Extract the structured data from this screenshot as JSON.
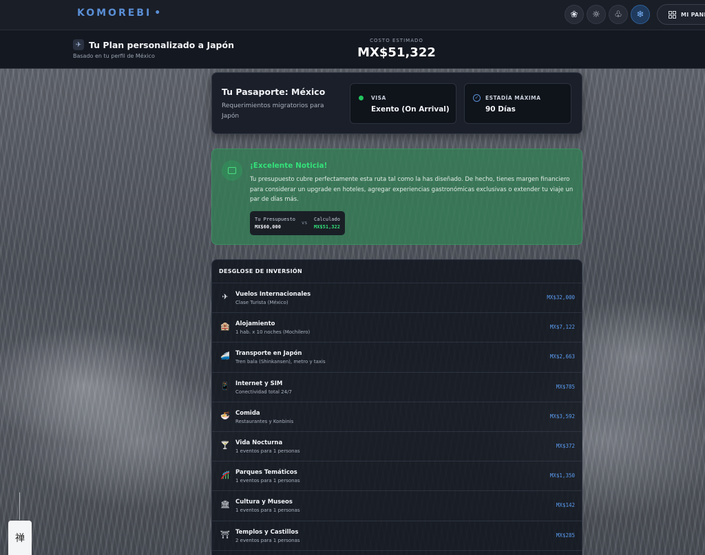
{
  "app": {
    "logo": "KOMOREBI",
    "logo_dot": "•"
  },
  "theme_buttons": [
    {
      "name": "lotus-theme-icon",
      "glyph": "❀",
      "active": false
    },
    {
      "name": "sun-theme-icon",
      "glyph": "☼",
      "active": false
    },
    {
      "name": "tree-theme-icon",
      "glyph": "♧",
      "active": false
    },
    {
      "name": "snowflake-theme-icon",
      "glyph": "❄",
      "active": true
    }
  ],
  "panel_button": {
    "label": "MI PANEL",
    "icon": "grid-icon"
  },
  "plan": {
    "title": "Tu Plan personalizado a Japón",
    "subtitle": "Basado en tu perfil de México",
    "icon": "plane-icon"
  },
  "cost": {
    "label": "COSTO ESTIMADO",
    "value": "MX$51,322"
  },
  "passport": {
    "title": "Tu Pasaporte: México",
    "description": "Requerimientos migratorios para Japón",
    "visa": {
      "label": "VISA",
      "value": "Exento (On Arrival)",
      "status_color": "#22c55e"
    },
    "stay": {
      "label": "ESTADÍA MÁXIMA",
      "value": "90 Días"
    }
  },
  "notice": {
    "title": "¡Excelente Noticia!",
    "text": "Tu presupuesto cubre perfectamente esta ruta tal como la has diseñado. De hecho, tienes margen financiero para considerar un upgrade en hoteles, agregar experiencias gastronómicas exclusivas o extender tu viaje un par de días más.",
    "budget_label": "Tu Presupuesto",
    "budget_value": "MX$60,000",
    "vs": "vs",
    "calc_label": "Calculado",
    "calc_value": "MX$51,322"
  },
  "breakdown": {
    "title": "DESGLOSE DE INVERSIÓN",
    "rows": [
      {
        "icon": "✈",
        "icon_name": "airplane-icon",
        "name": "Vuelos Internacionales",
        "desc": "Clase Turista (México)",
        "price": "MX$32,000"
      },
      {
        "icon": "🏨",
        "icon_name": "hotel-icon",
        "name": "Alojamiento",
        "desc": "1 hab. x 10 noches (Mochilero)",
        "price": "MX$7,122"
      },
      {
        "icon": "🚄",
        "icon_name": "train-icon",
        "name": "Transporte en Japón",
        "desc": "Tren bala (Shinkansen), metro y taxis",
        "price": "MX$2,663"
      },
      {
        "icon": "📱",
        "icon_name": "phone-icon",
        "name": "Internet y SIM",
        "desc": "Conectividad total 24/7",
        "price": "MX$785"
      },
      {
        "icon": "🍜",
        "icon_name": "noodles-icon",
        "name": "Comida",
        "desc": "Restaurantes y Konbinis",
        "price": "MX$3,592"
      },
      {
        "icon": "🍸",
        "icon_name": "cocktail-icon",
        "name": "Vida Nocturna",
        "desc": "1 eventos para 1 personas",
        "price": "MX$372"
      },
      {
        "icon": "🎢",
        "icon_name": "roller-coaster-icon",
        "name": "Parques Temáticos",
        "desc": "1 eventos para 1 personas",
        "price": "MX$1,350"
      },
      {
        "icon": "🏛",
        "icon_name": "museum-icon",
        "name": "Cultura y Museos",
        "desc": "1 eventos para 1 personas",
        "price": "MX$142"
      },
      {
        "icon": "⛩",
        "icon_name": "torii-gate-icon",
        "name": "Templos y Castillos",
        "desc": "2 eventos para 1 personas",
        "price": "MX$285"
      }
    ]
  },
  "zen_button": {
    "glyph": "禅"
  }
}
